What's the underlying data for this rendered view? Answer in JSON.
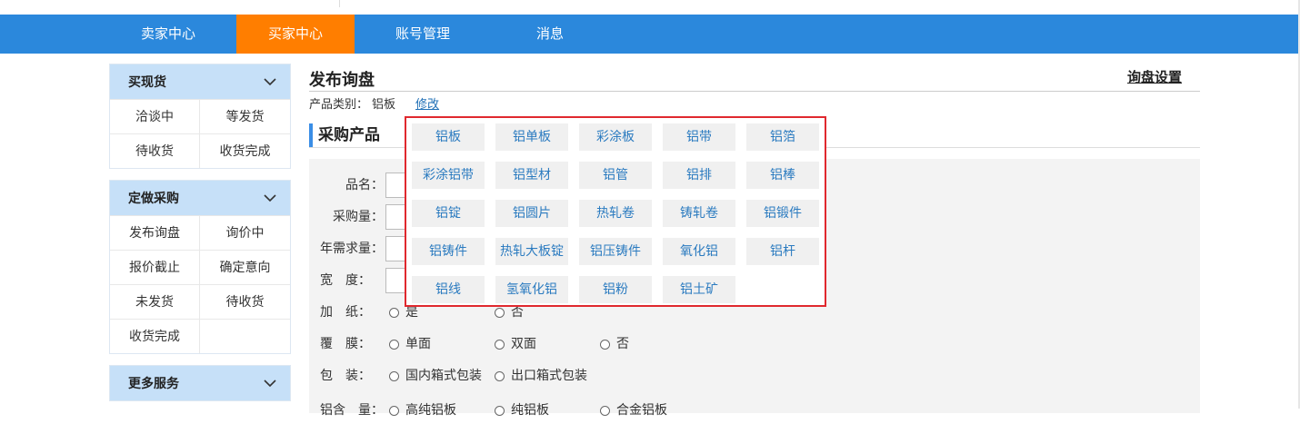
{
  "nav": [
    "卖家中心",
    "买家中心",
    "账号管理",
    "消息"
  ],
  "sidebar": {
    "groups": [
      {
        "title": "买现货",
        "items": [
          "洽谈中",
          "等发货",
          "待收货",
          "收货完成"
        ]
      },
      {
        "title": "定做采购",
        "items": [
          "发布询盘",
          "询价中",
          "报价截止",
          "确定意向",
          "未发货",
          "待收货",
          "收货完成"
        ]
      },
      {
        "title": "更多服务",
        "items": []
      }
    ]
  },
  "main": {
    "title": "发布询盘",
    "settings_link": "询盘设置",
    "category_label": "产品类别：",
    "category_value": "铝板",
    "edit_link": "修改",
    "section_title": "采购产品"
  },
  "form": {
    "labels": [
      "品名：",
      "采购量：",
      "年需求量：",
      "宽　度：",
      "加　纸：",
      "覆　膜：",
      "包　装：",
      "铝含　量："
    ],
    "paper_options": [
      "是",
      "否"
    ],
    "film_options": [
      "单面",
      "双面",
      "否"
    ],
    "packing_options": [
      "国内箱式包装",
      "出口箱式包装"
    ],
    "aluminum_options": [
      "高纯铝板",
      "纯铝板",
      "合金铝板"
    ]
  },
  "product_types": [
    "铝板",
    "铝单板",
    "彩涂板",
    "铝带",
    "铝箔",
    "彩涂铝带",
    "铝型材",
    "铝管",
    "铝排",
    "铝棒",
    "铝锭",
    "铝圆片",
    "热轧卷",
    "铸轧卷",
    "铝锻件",
    "铝铸件",
    "热轧大板锭",
    "铝压铸件",
    "氧化铝",
    "铝杆",
    "铝线",
    "氢氧化铝",
    "铝粉",
    "铝土矿"
  ],
  "colors": {
    "nav_bg": "#2b88dc",
    "nav_active": "#ff7e00",
    "sidebar_head": "#c6e0f8",
    "link": "#1f6fb6",
    "popup_border": "#e0282e",
    "chip_text": "#2b7bc0"
  }
}
